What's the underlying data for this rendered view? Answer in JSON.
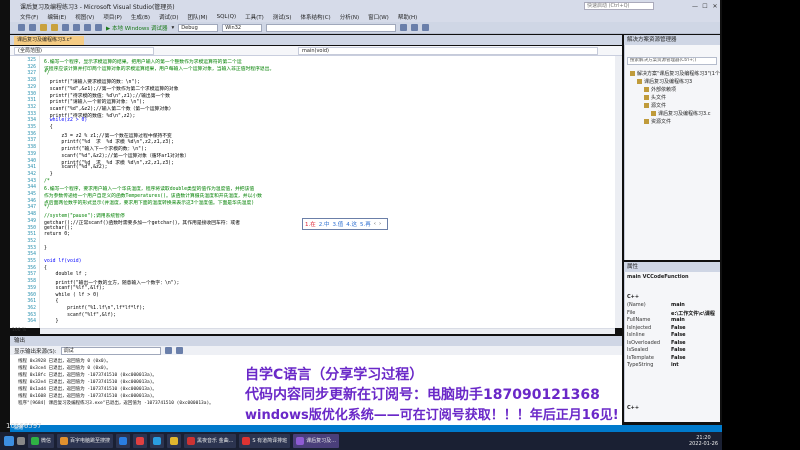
{
  "window": {
    "title": "课后复习及编程练习3 - Microsoft Visual Studio(管理员)",
    "search_placeholder": "快速启动 (Ctrl+Q)",
    "min": "—",
    "max": "☐",
    "close": "✕"
  },
  "menu": [
    "文件(F)",
    "编辑(E)",
    "视图(V)",
    "项目(P)",
    "生成(B)",
    "调试(D)",
    "团队(M)",
    "SQL(Q)",
    "工具(T)",
    "测试(S)",
    "体系结构(C)",
    "分析(N)",
    "窗口(W)",
    "帮助(H)"
  ],
  "toolbar": {
    "debugger": "▶ 本地 Windows 调试器",
    "config": "Debug",
    "platform": "Win32",
    "dropdown_arrow": "▾"
  },
  "editor": {
    "tab": "课后复习及编程练习3.c*",
    "nav_scope": "(全局范围)",
    "nav_member": "main(void)",
    "lines": [
      {
        "n": "325",
        "t": "6.编写一个程序，显示求模运算的结果。把用户输入的第一个整数作为求模运算符的第二个运",
        "cls": "c-com"
      },
      {
        "n": "326",
        "t": "该程序应该计算并打印两个运算对象的求模运算结果，用户每输入一个运算对象，当输入非正值时程序退出。",
        "cls": "c-com"
      },
      {
        "n": "327",
        "t": "*/",
        "cls": "c-com"
      },
      {
        "n": "328",
        "t": "  printf(\"请输入要求模运算的数：\\n\");",
        "cls": ""
      },
      {
        "n": "329",
        "t": "  scanf(\"%d\",&z1);//第一个数作为第二个求模运算的对象",
        "cls": ""
      },
      {
        "n": "330",
        "t": "  printf(\"待求模的数值：%d\\n\",z1);//输出第一个数",
        "cls": ""
      },
      {
        "n": "331",
        "t": "  printf(\"请输入一个新的运算对象：\\n\");",
        "cls": ""
      },
      {
        "n": "332",
        "t": "  scanf(\"%d\",&z2);//输入第二个数（第一个运算对象）",
        "cls": ""
      },
      {
        "n": "333",
        "t": "  printf(\"待求模的数值：%d\\n\",z2);",
        "cls": ""
      },
      {
        "n": "334",
        "t": "  while(z2 > 0)",
        "cls": "c-key"
      },
      {
        "n": "335",
        "t": "  {",
        "cls": ""
      },
      {
        "n": "336",
        "t": "      z3 = z2 % z1;//第一个数在运算过程中保持不变",
        "cls": ""
      },
      {
        "n": "337",
        "t": "      printf(\"%d  求  %d 求模 %d\\n\",z2,z1,z3);",
        "cls": ""
      },
      {
        "n": "338",
        "t": "      printf(\"输入下一个求模的数：\\n\");",
        "cls": ""
      },
      {
        "n": "339",
        "t": "      scanf(\"%d\",&z2);//第一个运算对象（循环ar1对对象）",
        "cls": ""
      },
      {
        "n": "340",
        "t": "      printf(\"%d  求  %d 求模 %d\\n\",z2,z1,z3);",
        "cls": ""
      },
      {
        "n": "341",
        "t": "      scanf(\"%d\",&z2);",
        "cls": ""
      },
      {
        "n": "342",
        "t": "  }",
        "cls": ""
      },
      {
        "n": "343",
        "t": "/*",
        "cls": "c-com"
      },
      {
        "n": "344",
        "t": "6.编写一个程序，要求用户输入一个华氏温度，程序将读取double类型的值作为温度值，并把该值",
        "cls": "c-com"
      },
      {
        "n": "345",
        "t": "作为参数传递给一个用户自定义的函数Temperatures()。该函数计算摄氏温度和开氏温度，并以小数",
        "cls": "c-com"
      },
      {
        "n": "346",
        "t": "点后面两位数字的形式显示(并温度，要求用下面的温度转换来表示这3个温度值。下面是华氏温度)",
        "cls": "c-com"
      },
      {
        "n": "347",
        "t": "*/",
        "cls": "c-com"
      },
      {
        "n": "348",
        "t": "//system(\"pause\");调用系统暂停",
        "cls": "c-com"
      },
      {
        "n": "349",
        "t": "getchar();//正常scanf()函数时需要多加一个getchar()，其作用是接收回车符：或者",
        "cls": ""
      },
      {
        "n": "350",
        "t": "getchar();",
        "cls": ""
      },
      {
        "n": "351",
        "t": "return 0;",
        "cls": ""
      },
      {
        "n": "352",
        "t": "",
        "cls": ""
      },
      {
        "n": "353",
        "t": "}",
        "cls": ""
      },
      {
        "n": "354",
        "t": "",
        "cls": ""
      },
      {
        "n": "355",
        "t": "void lf(void)",
        "cls": "c-key"
      },
      {
        "n": "356",
        "t": "{",
        "cls": ""
      },
      {
        "n": "357",
        "t": "    double lf ;",
        "cls": ""
      },
      {
        "n": "358",
        "t": "    printf(\"输出一个数的立方，随意输入一个数字：\\n\");",
        "cls": ""
      },
      {
        "n": "359",
        "t": "    scanf(\"%lf\",&lf);",
        "cls": ""
      },
      {
        "n": "360",
        "t": "    while ( lf > 0)",
        "cls": ""
      },
      {
        "n": "361",
        "t": "    {",
        "cls": ""
      },
      {
        "n": "362",
        "t": "        printf(\"%1.lf\\n\",lf*lf*lf);",
        "cls": ""
      },
      {
        "n": "363",
        "t": "        scanf(\"%lf\",&lf);",
        "cls": ""
      },
      {
        "n": "364",
        "t": "    }",
        "cls": ""
      }
    ],
    "autocomplete": [
      "1.在",
      "2.中",
      "3.值",
      "4.这",
      "5.再",
      "‹",
      "›"
    ],
    "zoom": "100 %"
  },
  "output": {
    "header": "输出",
    "source_label": "显示输出来源(S):",
    "source_value": "调试",
    "lines": [
      "线程 0x3928 已退出，返回值为 0 (0x0)。",
      "线程 0x3ce4 已退出，返回值为 0 (0x0)。",
      "线程 0x18fc 已退出，返回值为 -1073741510 (0xc000013a)。",
      "线程 0x32e4 已退出，返回值为 -1073741510 (0xc000013a)。",
      "线程 0x1ad4 已退出，返回值为 -1073741510 (0xc000013a)。",
      "线程 0x1608 已退出，返回值为 -1073741510 (0xc000013a)。",
      "程序\"[9684] 课后复习及编程练习3.exe\"已退出，返回值为 -1073741510 (0xc000013a)。"
    ]
  },
  "solution": {
    "header": "解决方案资源管理器",
    "search": "搜索解决方案资源管理器(Ctrl+;)",
    "items": [
      {
        "label": "解决方案\"课后复习及编程练习3\"(1个",
        "indent": 0
      },
      {
        "label": "课后复习及编程练习3",
        "indent": 1
      },
      {
        "label": "外部依赖项",
        "indent": 2
      },
      {
        "label": "头文件",
        "indent": 2
      },
      {
        "label": "源文件",
        "indent": 2
      },
      {
        "label": "课后复习及编程练习3.c",
        "indent": 3
      },
      {
        "label": "资源文件",
        "indent": 2
      }
    ]
  },
  "properties": {
    "header": "属性",
    "object": "main  VCCodeFunction",
    "category": "C++",
    "rows": [
      {
        "k": "(Name)",
        "v": "main"
      },
      {
        "k": "File",
        "v": "e:\\工作文件\\c\\课程"
      },
      {
        "k": "FullName",
        "v": "main"
      },
      {
        "k": "IsInjected",
        "v": "False"
      },
      {
        "k": "IsInline",
        "v": "False"
      },
      {
        "k": "IsOverloaded",
        "v": "False"
      },
      {
        "k": "IsSealed",
        "v": "False"
      },
      {
        "k": "IsTemplate",
        "v": "False"
      },
      {
        "k": "TypeString",
        "v": "int"
      }
    ],
    "footer": "C++"
  },
  "overlay": {
    "line1": "自学C语言（分享学习过程）",
    "line2": "代码内容同步更新在订阅号：电脑助手187090121368",
    "line3": "windows版优化系统——可在订阅号获取！！！年后正月16见!"
  },
  "watermark": "10566597",
  "statusbar": "就绪",
  "taskbar": {
    "items": [
      "微信",
      "百字电脑跳至搜搜",
      "",
      "",
      "",
      "",
      "黑夜音乐 金曲...",
      "S 有道简译排班",
      "课后复习及..."
    ],
    "time": "21:20",
    "date": "2022-01-26"
  }
}
